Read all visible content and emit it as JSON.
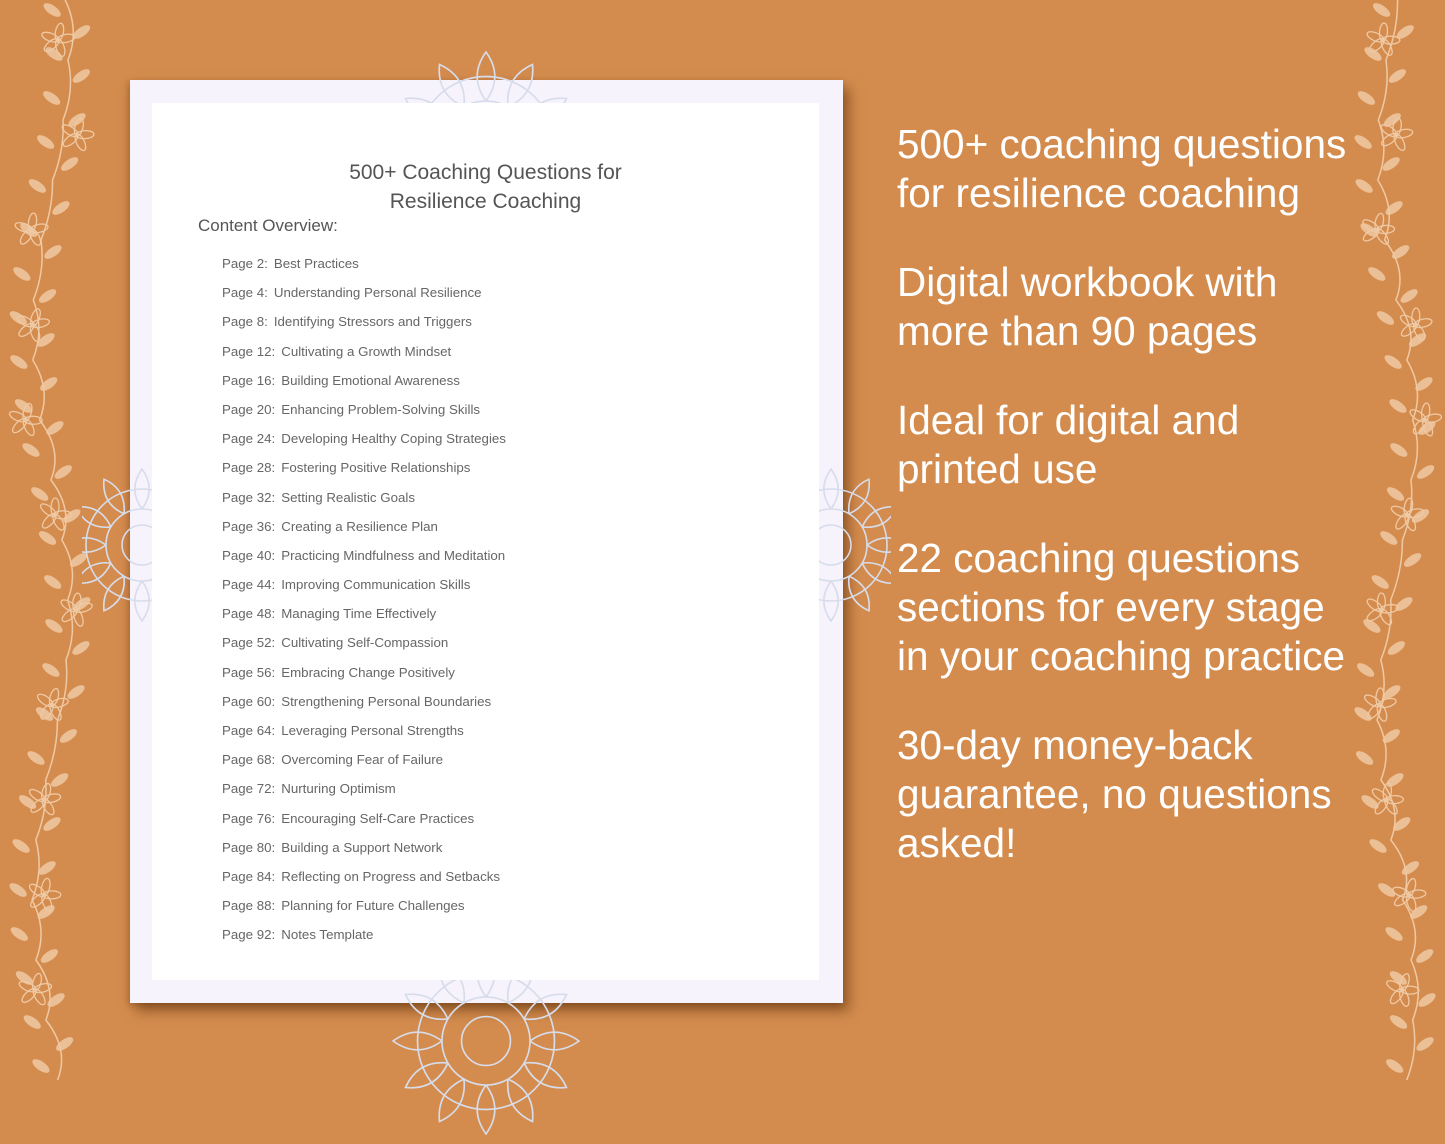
{
  "document": {
    "title_line1": "500+ Coaching Questions for",
    "title_line2": "Resilience Coaching",
    "overview_label": "Content Overview:",
    "toc": [
      {
        "page": "Page  2:",
        "topic": "Best Practices"
      },
      {
        "page": "Page  4:",
        "topic": "Understanding Personal Resilience"
      },
      {
        "page": "Page  8:",
        "topic": "Identifying Stressors and Triggers"
      },
      {
        "page": "Page 12:",
        "topic": "Cultivating a Growth Mindset"
      },
      {
        "page": "Page 16:",
        "topic": "Building Emotional Awareness"
      },
      {
        "page": "Page 20:",
        "topic": "Enhancing Problem-Solving Skills"
      },
      {
        "page": "Page 24:",
        "topic": "Developing Healthy Coping Strategies"
      },
      {
        "page": "Page 28:",
        "topic": "Fostering Positive Relationships"
      },
      {
        "page": "Page 32:",
        "topic": "Setting Realistic Goals"
      },
      {
        "page": "Page 36:",
        "topic": "Creating a Resilience Plan"
      },
      {
        "page": "Page 40:",
        "topic": "Practicing Mindfulness and Meditation"
      },
      {
        "page": "Page 44:",
        "topic": "Improving Communication Skills"
      },
      {
        "page": "Page 48:",
        "topic": "Managing Time Effectively"
      },
      {
        "page": "Page 52:",
        "topic": "Cultivating Self-Compassion"
      },
      {
        "page": "Page 56:",
        "topic": "Embracing Change Positively"
      },
      {
        "page": "Page 60:",
        "topic": "Strengthening Personal Boundaries"
      },
      {
        "page": "Page 64:",
        "topic": "Leveraging Personal Strengths"
      },
      {
        "page": "Page 68:",
        "topic": "Overcoming Fear of Failure"
      },
      {
        "page": "Page 72:",
        "topic": "Nurturing Optimism"
      },
      {
        "page": "Page 76:",
        "topic": "Encouraging Self-Care Practices"
      },
      {
        "page": "Page 80:",
        "topic": "Building a Support Network"
      },
      {
        "page": "Page 84:",
        "topic": "Reflecting on Progress and Setbacks"
      },
      {
        "page": "Page 88:",
        "topic": "Planning for Future Challenges"
      },
      {
        "page": "Page 92:",
        "topic": "Notes Template"
      }
    ]
  },
  "features": [
    "500+ coaching questions for resilience coaching",
    "Digital workbook with more than 90 pages",
    "Ideal for digital and printed use",
    "22 coaching questions sections for every stage in your coaching practice",
    "30-day money-back guarantee, no questions asked!"
  ],
  "colors": {
    "background": "#d48c4e",
    "vine": "#efc9a4",
    "page_frame": "#f6f3fd",
    "mandala": "#d7dcea",
    "text_dark": "#555555"
  }
}
